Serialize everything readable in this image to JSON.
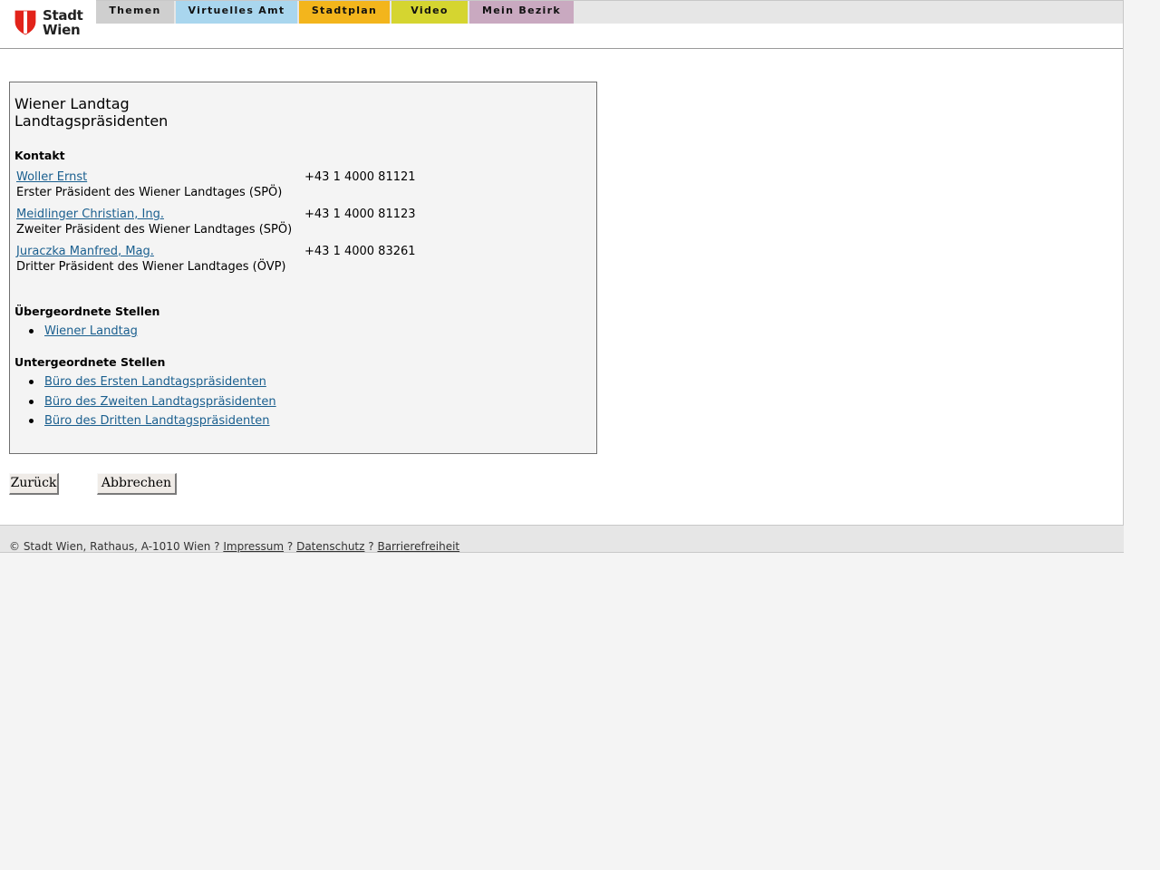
{
  "header": {
    "logo_line1": "Stadt",
    "logo_line2": "Wien",
    "nav": [
      {
        "label": "Themen",
        "color": "#cfcfcf"
      },
      {
        "label": "Virtuelles Amt",
        "color": "#a9d6ee"
      },
      {
        "label": "Stadtplan",
        "color": "#f3b51c"
      },
      {
        "label": "Video",
        "color": "#d5d530"
      },
      {
        "label": "Mein Bezirk",
        "color": "#c9a9c0"
      }
    ]
  },
  "content": {
    "title_line1": "Wiener Landtag",
    "title_line2": "Landtagspräsidenten",
    "contact_heading": "Kontakt",
    "contacts": [
      {
        "name": "Woller Ernst",
        "role": "Erster Präsident des Wiener Landtages (SPÖ)",
        "phone": "+43 1 4000 81121"
      },
      {
        "name": "Meidlinger Christian, Ing.",
        "role": "Zweiter Präsident des Wiener Landtages (SPÖ)",
        "phone": "+43 1 4000 81123"
      },
      {
        "name": "Juraczka Manfred, Mag.",
        "role": "Dritter Präsident des Wiener Landtages (ÖVP)",
        "phone": "+43 1 4000 83261"
      }
    ],
    "parent_heading": "Übergeordnete Stellen",
    "parent_links": [
      "Wiener Landtag"
    ],
    "child_heading": "Untergeordnete Stellen",
    "child_links": [
      "Büro des Ersten Landtagspräsidenten",
      "Büro des Zweiten Landtagspräsidenten",
      "Büro des Dritten Landtagspräsidenten"
    ]
  },
  "buttons": {
    "back": "Zurück",
    "cancel": "Abbrechen"
  },
  "footer": {
    "copyright": "© Stadt Wien, Rathaus, A-1010 Wien",
    "separator": "?",
    "links": [
      "Impressum",
      "Datenschutz",
      "Barrierefreiheit"
    ]
  },
  "colors": {
    "link": "#1a5f8f",
    "wien_red": "#e2231a"
  }
}
